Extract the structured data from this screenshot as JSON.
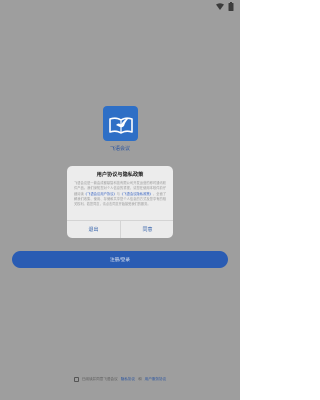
{
  "app": {
    "name": "飞语会议"
  },
  "dialog": {
    "title": "用户协议与隐私政策",
    "body_intro": "飞语会议是一款由成都鼎智科技有限公司开发运营的即时通讯软件产品。我们深知您对个人信息的重视，请您在使用本软件前仔细阅读",
    "link_user_agreement": "《飞语会议用户协议》",
    "body_and": "与",
    "link_privacy": "《飞语会议隐私政策》",
    "body_outro": "，全面了解我们收集、使用、存储和共享您个人信息的方式及您享有的相关权利。若您同意，请点击同意开始接受我们的服务。",
    "exit_label": "退出",
    "agree_label": "同意"
  },
  "main": {
    "login_label": "注册/登录"
  },
  "footer": {
    "prefix": "已阅读并同意飞语会议",
    "link_privacy": "隐私协议",
    "and": "和",
    "link_user": "用户服务协议"
  },
  "colors": {
    "overlay": "#9e9e9e",
    "brand": "#2a5cb3",
    "link": "#3a66c4"
  }
}
